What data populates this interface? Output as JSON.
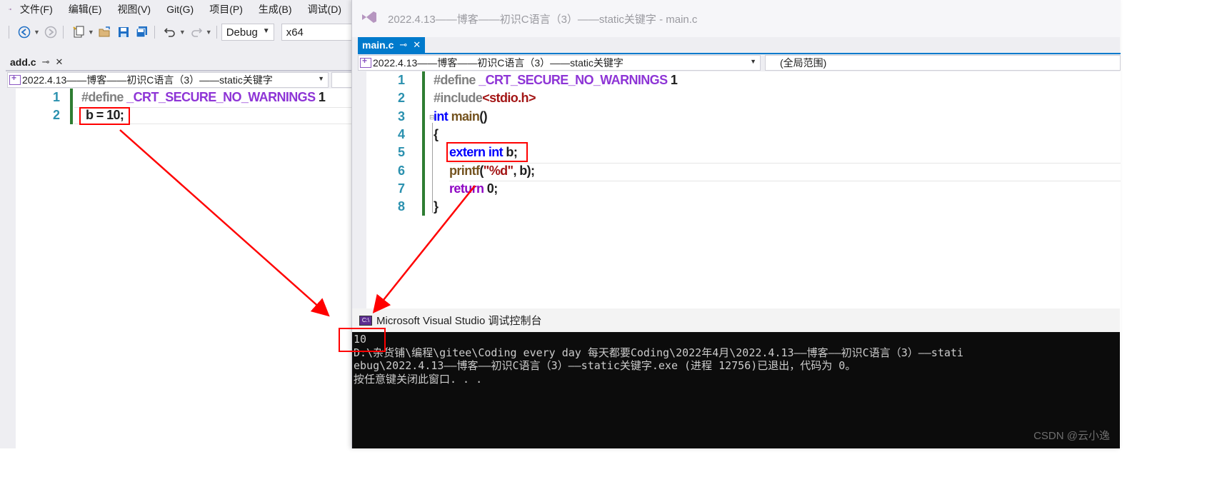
{
  "left_window": {
    "menu": [
      "文件(F)",
      "编辑(E)",
      "视图(V)",
      "Git(G)",
      "项目(P)",
      "生成(B)",
      "调试(D)"
    ],
    "toolbar": {
      "config": "Debug",
      "platform": "x64"
    },
    "tab": {
      "label": "add.c",
      "pin": "⊸",
      "close": "✕"
    },
    "nav_dropdown": "2022.4.13——博客——初识C语言（3）——static关键字",
    "lines": [
      {
        "num": "1",
        "parts": [
          "#define",
          " _CRT_SECURE_NO_WARNINGS",
          " 1"
        ]
      },
      {
        "num": "2",
        "text": "b = 10;"
      }
    ]
  },
  "right_window": {
    "title": "2022.4.13——博客——初识C语言（3）——static关键字 - main.c",
    "tab": {
      "label": "main.c",
      "pin": "⊸",
      "close": "✕"
    },
    "nav_dropdown": "2022.4.13——博客——初识C语言（3）——static关键字",
    "scope_dropdown": "(全局范围)",
    "lines": [
      {
        "num": "1",
        "parts": [
          "#define",
          " _CRT_SECURE_NO_WARNINGS",
          " 1"
        ]
      },
      {
        "num": "2",
        "parts": [
          "#include",
          "<stdio.h>"
        ]
      },
      {
        "num": "3",
        "parts": [
          "int",
          " main",
          "()"
        ]
      },
      {
        "num": "4",
        "parts": [
          "{"
        ]
      },
      {
        "num": "5",
        "parts": [
          "extern",
          " int",
          " b;"
        ]
      },
      {
        "num": "6",
        "parts": [
          "printf",
          "(",
          "\"%d\"",
          ", b);"
        ]
      },
      {
        "num": "7",
        "parts": [
          "return",
          " 0;"
        ]
      },
      {
        "num": "8",
        "parts": [
          "}"
        ]
      }
    ]
  },
  "console": {
    "title": "Microsoft Visual Studio 调试控制台",
    "icon": "C:\\",
    "lines": [
      "10",
      "D:\\杂货铺\\编程\\gitee\\Coding every day 每天都要Coding\\2022年4月\\2022.4.13——博客——初识C语言（3）——stati",
      "ebug\\2022.4.13——博客——初识C语言（3）——static关键字.exe (进程 12756)已退出，代码为 0。",
      "按任意键关闭此窗口. . ."
    ]
  },
  "watermark": "CSDN @云小逸",
  "colors": {
    "annotation": "#ff0000",
    "accent": "#007acc"
  }
}
